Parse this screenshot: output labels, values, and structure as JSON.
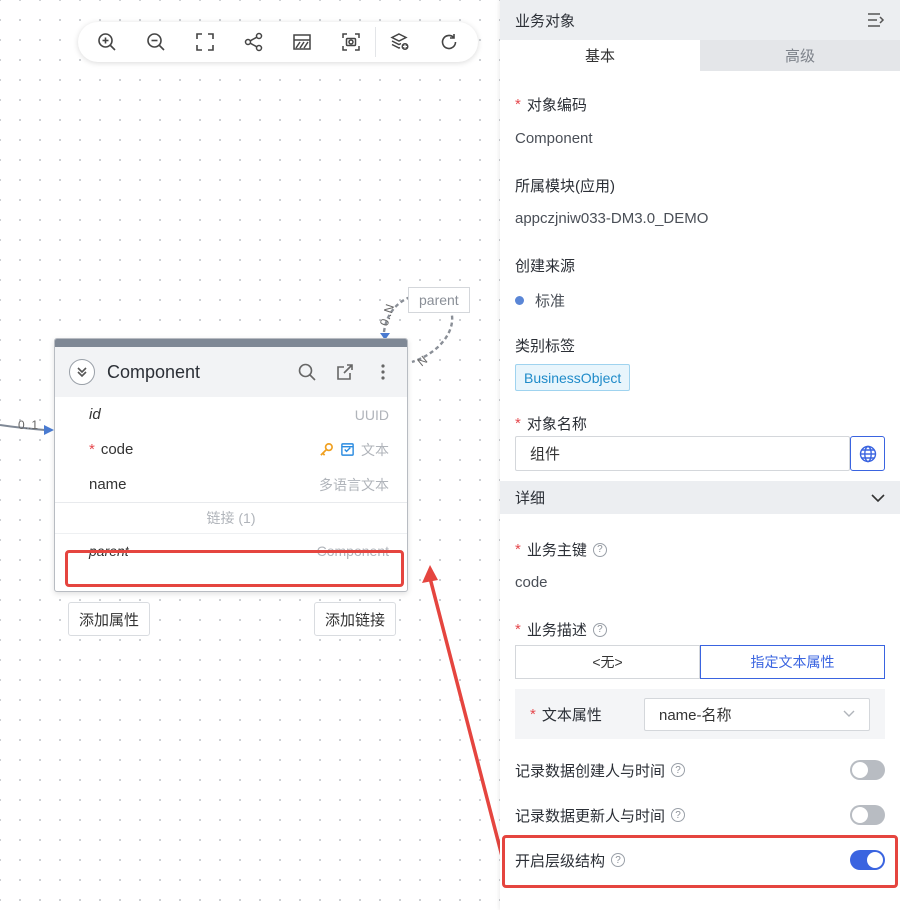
{
  "toolbar": {
    "buttons": [
      "zoom-in-icon",
      "zoom-out-icon",
      "fit-screen-icon",
      "share-icon",
      "grid-icon",
      "screenshot-icon",
      "layers-add-icon",
      "refresh-icon"
    ]
  },
  "node": {
    "title": "Component",
    "attributes": [
      {
        "name": "id",
        "type": "UUID",
        "italic": true,
        "required": false
      },
      {
        "name": "code",
        "type": "文本",
        "italic": false,
        "required": true
      },
      {
        "name": "name",
        "type": "多语言文本",
        "italic": false,
        "required": false
      }
    ],
    "links_caption": "链接 (1)",
    "link": {
      "name": "parent",
      "target": "Component"
    },
    "add_attribute_label": "添加属性",
    "add_link_label": "添加链接"
  },
  "relation": {
    "self_label": "parent",
    "mult_start": "0..N",
    "mult_end": "N",
    "incoming_mult": "0..1"
  },
  "panel": {
    "title": "业务对象",
    "tabs": [
      "基本",
      "高级"
    ],
    "object_code_label": "对象编码",
    "object_code_value": "Component",
    "module_label": "所属模块(应用)",
    "module_value": "appczjniw033-DM3.0_DEMO",
    "source_label": "创建来源",
    "source_value": "标准",
    "category_label": "类别标签",
    "category_tag": "BusinessObject",
    "name_label": "对象名称",
    "name_value": "组件",
    "detail_section": "详细",
    "key_label": "业务主键",
    "key_value": "code",
    "desc_label": "业务描述",
    "desc_options": [
      "<无>",
      "指定文本属性"
    ],
    "text_attr_label": "文本属性",
    "text_attr_value": "name-名称",
    "toggles": [
      {
        "label": "记录数据创建人与时间",
        "on": false
      },
      {
        "label": "记录数据更新人与时间",
        "on": false
      },
      {
        "label": "开启层级结构",
        "on": true
      }
    ]
  },
  "colors": {
    "accent": "#3a64e0",
    "highlight": "#e5453f",
    "required": "#e5484d"
  }
}
